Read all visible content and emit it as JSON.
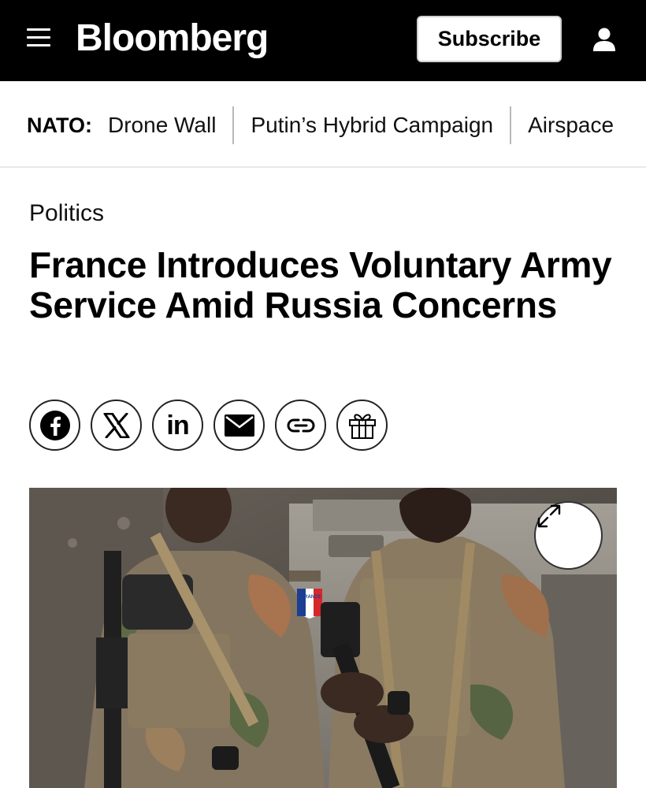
{
  "header": {
    "logo": "Bloomberg",
    "subscribe_label": "Subscribe",
    "menu_icon": "hamburger-menu-icon",
    "account_icon": "user-icon"
  },
  "topic_bar": {
    "prefix": "NATO:",
    "items": [
      "Drone Wall",
      "Putin’s Hybrid Campaign",
      "Airspace"
    ]
  },
  "article": {
    "section": "Politics",
    "headline": "France Introduces Voluntary Army Service Amid Russia Concerns",
    "share_icons": [
      "facebook-icon",
      "x-icon",
      "linkedin-icon",
      "email-icon",
      "link-icon",
      "gift-icon"
    ],
    "linkedin_text": "in",
    "photo": {
      "badge_text": "FRANCE",
      "expand_icon": "expand-icon"
    }
  },
  "colors": {
    "header_bg": "#000000",
    "text": "#000000",
    "divider": "#b8b8b8"
  }
}
